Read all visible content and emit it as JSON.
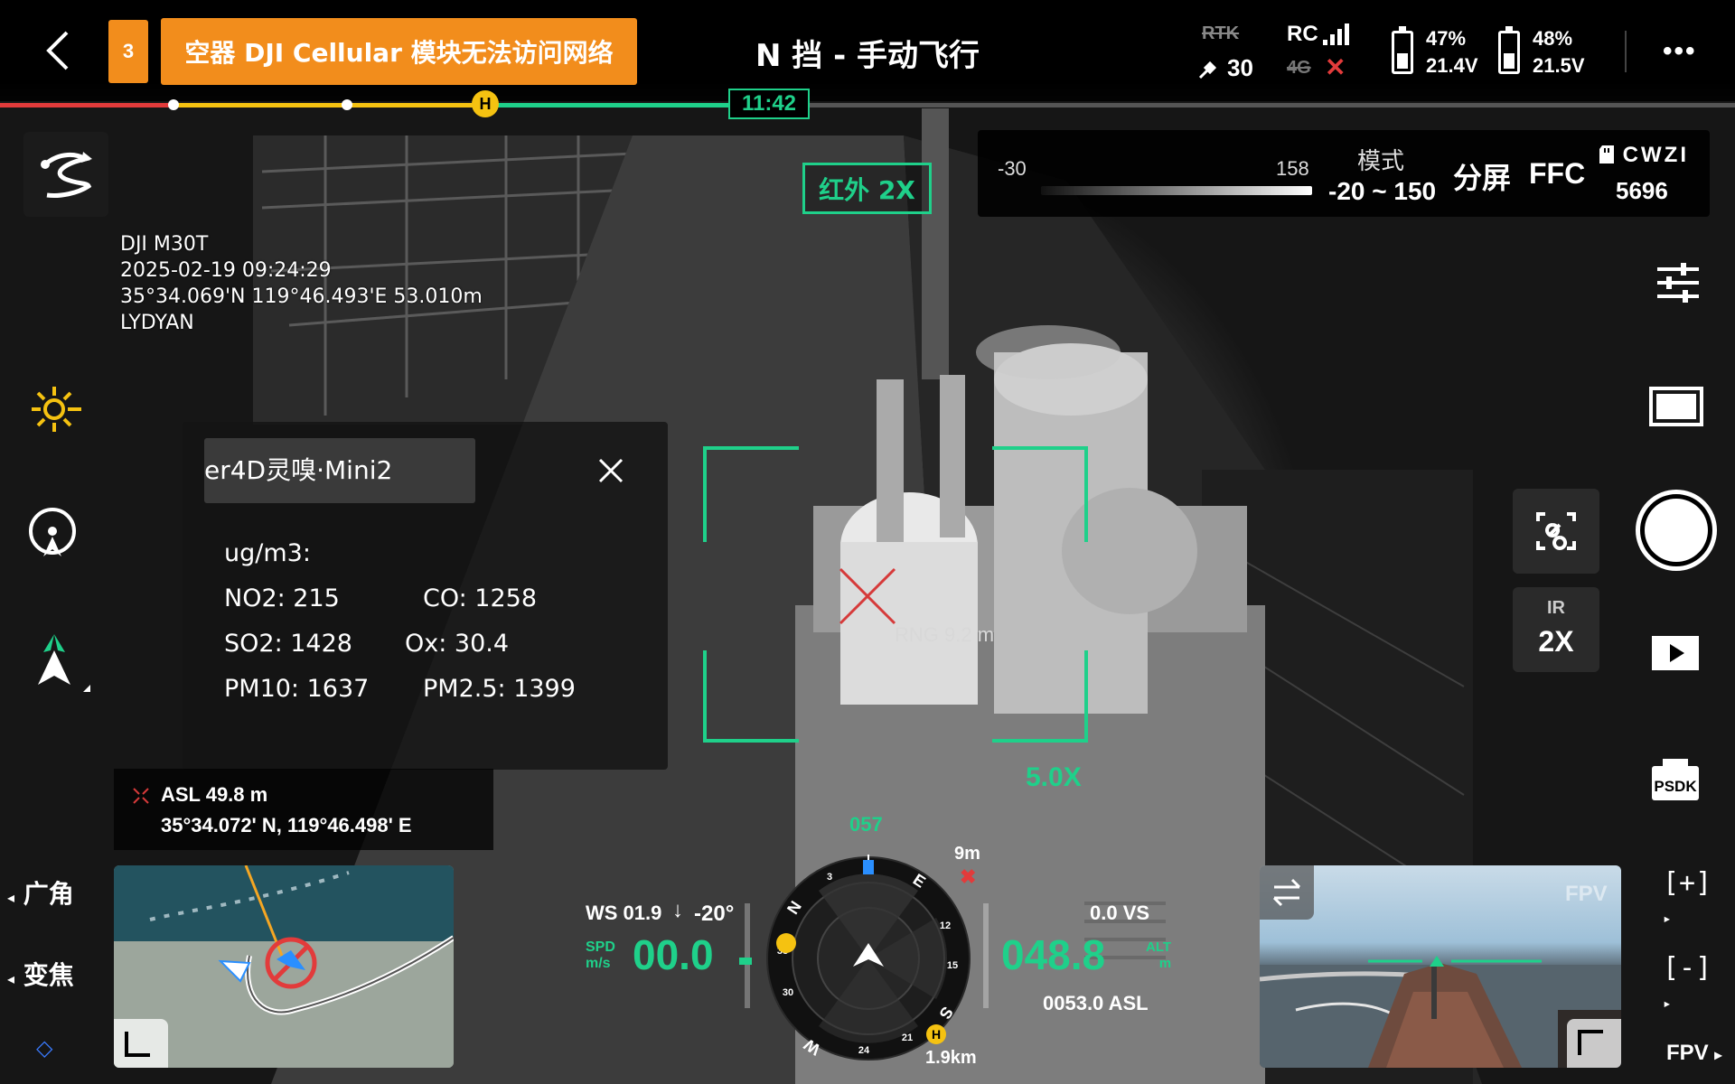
{
  "top_bar": {
    "notification_count": "3",
    "warning_text": "空器 DJI Cellular 模块无法访问网络",
    "flight_mode": "N 挡 - 手动飞行",
    "rtk_label": "RTK",
    "satellite_count": "30",
    "rc_label": "RC",
    "rc_4g_label": "4G",
    "battery_1": {
      "percent": "47%",
      "voltage": "21.4V",
      "level": 0.47
    },
    "battery_2": {
      "percent": "48%",
      "voltage": "21.5V",
      "level": 0.48
    },
    "timeline_time": "11:42",
    "timeline_home_label": "H"
  },
  "osd": {
    "model": "DJI M30T",
    "datetime": "2025-02-19 09:24:29",
    "position": "35°34.069'N 119°46.493'E 53.010m",
    "operator": "LYDYAN"
  },
  "sensor_panel": {
    "title": "er4D灵嗅·Mini2",
    "unit": "ug/m3:",
    "readings": [
      {
        "label": "NO2: 215"
      },
      {
        "label": "CO: 1258"
      },
      {
        "label": "SO2: 1428"
      },
      {
        "label": "Ox: 30.4"
      },
      {
        "label": "PM10: 1637"
      },
      {
        "label": "PM2.5: 1399"
      }
    ]
  },
  "camera": {
    "ir_badge": "红外  2X",
    "zoom_label": "5.0X",
    "range_label": "RNG 9.2 m"
  },
  "thermal_panel": {
    "min_temp": "-30",
    "max_temp": "158",
    "mode_label": "模式",
    "mode_range": "-20 ~ 150",
    "split_label": "分屏",
    "ffc_label": "FFC",
    "storage_label": "CWZI",
    "storage_count": "5696"
  },
  "right_rail": {
    "ir_zoom_label": "IR",
    "ir_zoom_value": "2X",
    "psdk_label": "PSDK"
  },
  "location": {
    "asl": "ASL 49.8 m",
    "coords": "35°34.072' N, 119°46.498' E"
  },
  "lens": {
    "wide_label": "广角",
    "zoom_label": "变焦"
  },
  "flight_data": {
    "wind": "WS 01.9",
    "wind_dir": "-20°",
    "spd_label": "SPD",
    "spd_unit": "m/s",
    "speed": "00.0",
    "heading": "057",
    "obstacle_dist": "9m",
    "altitude": "048.8",
    "alt_label": "ALT",
    "alt_unit": "m",
    "vs": "0.0 VS",
    "asl": "0053.0 ASL",
    "home_dist": "1.9km",
    "home_label": "H",
    "compass": {
      "n": "N",
      "e": "E",
      "s": "S",
      "w": "W",
      "t3": "3",
      "t6": "6",
      "t12": "12",
      "t15": "15",
      "t21": "21",
      "t24": "24",
      "t30": "30",
      "t33": "33"
    }
  },
  "fpv": {
    "watermark": "FPV",
    "label": "FPV",
    "zoom_in": "[+]",
    "zoom_out": "[-]"
  }
}
